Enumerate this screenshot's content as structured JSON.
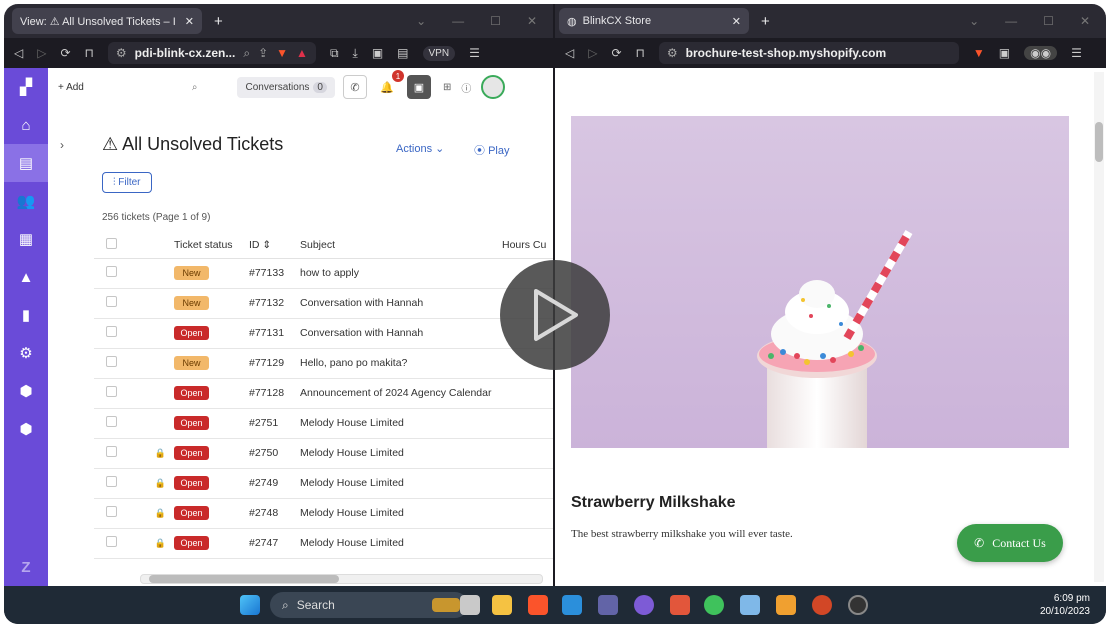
{
  "left_browser": {
    "tab_title": "View: ⚠ All Unsolved Tickets – I",
    "url": "pdi-blink-cx.zen...",
    "vpn_label": "VPN"
  },
  "right_browser": {
    "tab_title": "BlinkCX Store",
    "url": "brochure-test-shop.myshopify.com"
  },
  "zendesk": {
    "add_label": "+ Add",
    "conversations_label": "Conversations",
    "conversations_count": "0",
    "notification_count": "1",
    "page_title": "⚠ All Unsolved Tickets",
    "actions_label": "Actions",
    "play_label": "Play",
    "filter_label": "Filter",
    "ticket_count": "256 tickets (Page 1 of 9)",
    "columns": [
      "Ticket status",
      "ID",
      "Subject",
      "Hours Cu"
    ],
    "rows": [
      {
        "locked": false,
        "status": "New",
        "id": "#77133",
        "subject": "how to apply"
      },
      {
        "locked": false,
        "status": "New",
        "id": "#77132",
        "subject": "Conversation with Hannah"
      },
      {
        "locked": false,
        "status": "Open",
        "id": "#77131",
        "subject": "Conversation with Hannah"
      },
      {
        "locked": false,
        "status": "New",
        "id": "#77129",
        "subject": "Hello, pano po makita?"
      },
      {
        "locked": false,
        "status": "Open",
        "id": "#77128",
        "subject": "Announcement of 2024 Agency Calendar"
      },
      {
        "locked": false,
        "status": "Open",
        "id": "#2751",
        "subject": "Melody House Limited"
      },
      {
        "locked": true,
        "status": "Open",
        "id": "#2750",
        "subject": "Melody House Limited"
      },
      {
        "locked": true,
        "status": "Open",
        "id": "#2749",
        "subject": "Melody House Limited"
      },
      {
        "locked": true,
        "status": "Open",
        "id": "#2748",
        "subject": "Melody House Limited"
      },
      {
        "locked": true,
        "status": "Open",
        "id": "#2747",
        "subject": "Melody House Limited"
      }
    ]
  },
  "store": {
    "product_title": "Strawberry Milkshake",
    "product_description": "The best strawberry milkshake you will ever taste.",
    "contact_label": "Contact Us"
  },
  "taskbar": {
    "search_label": "Search",
    "time": "6:09 pm",
    "date": "20/10/2023"
  },
  "colors": {
    "sidebar": "#6a4bd8",
    "status_new": "#f2b86a",
    "status_open": "#c92a2a",
    "contact_button": "#3a9d4a"
  }
}
